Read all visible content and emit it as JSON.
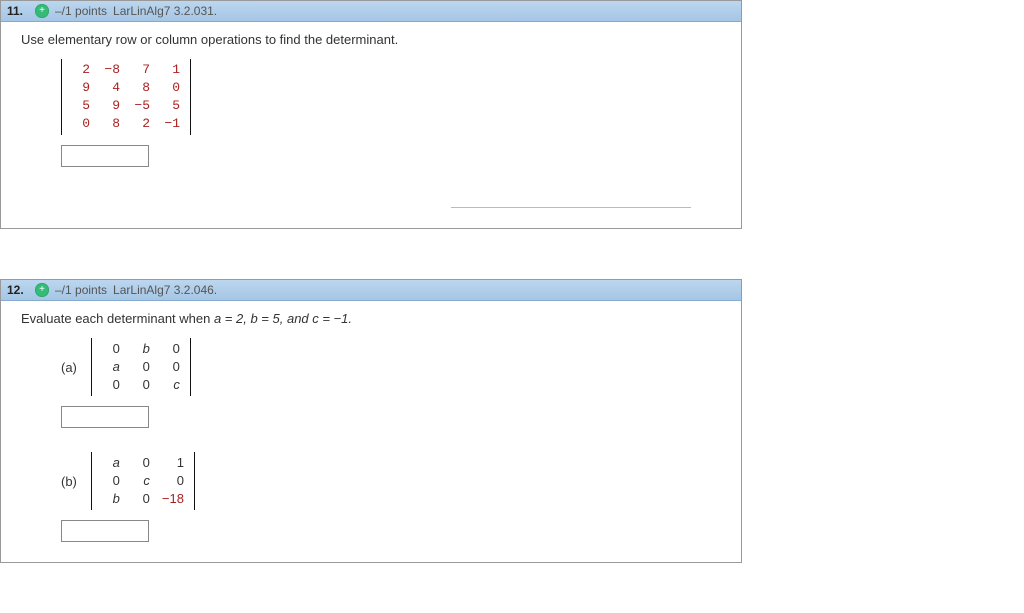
{
  "questions": [
    {
      "number": "11.",
      "points_label": "–/1 points",
      "source": "LarLinAlg7 3.2.031.",
      "prompt": "Use elementary row or column operations to find the determinant.",
      "matrix": [
        [
          "2",
          "−8",
          "7",
          "1"
        ],
        [
          "9",
          "4",
          "8",
          "0"
        ],
        [
          "5",
          "9",
          "−5",
          "5"
        ],
        [
          "0",
          "8",
          "2",
          "−1"
        ]
      ],
      "answer": ""
    },
    {
      "number": "12.",
      "points_label": "–/1 points",
      "source": "LarLinAlg7 3.2.046.",
      "prompt_prefix": "Evaluate each determinant when ",
      "prompt_vars": "a = 2,   b = 5,   and  c = −1.",
      "parts": [
        {
          "label": "(a)",
          "matrix": [
            [
              "0",
              "b",
              "0"
            ],
            [
              "a",
              "0",
              "0"
            ],
            [
              "0",
              "0",
              "c"
            ]
          ],
          "answer": ""
        },
        {
          "label": "(b)",
          "matrix": [
            [
              "a",
              "0",
              "1"
            ],
            [
              "0",
              "c",
              "0"
            ],
            [
              "b",
              "0",
              "−18"
            ]
          ],
          "answer": ""
        }
      ]
    }
  ]
}
